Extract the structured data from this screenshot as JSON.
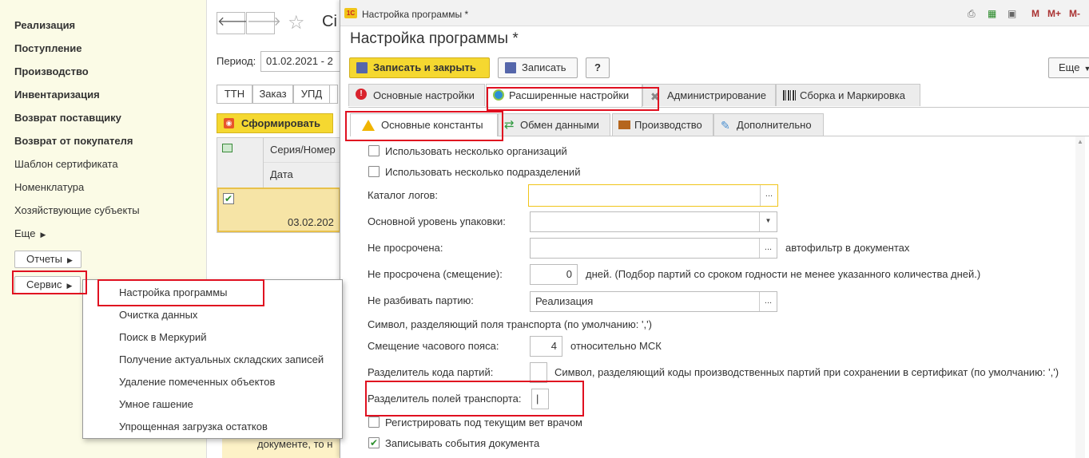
{
  "sidebar": {
    "items": [
      {
        "label": "Реализация",
        "bold": true
      },
      {
        "label": "Поступление",
        "bold": true
      },
      {
        "label": "Производство",
        "bold": true
      },
      {
        "label": "Инвентаризация",
        "bold": true
      },
      {
        "label": "Возврат поставщику",
        "bold": true
      },
      {
        "label": "Возврат от покупателя",
        "bold": true
      },
      {
        "label": "Шаблон сертификата",
        "bold": false
      },
      {
        "label": "Номенклатура",
        "bold": false
      },
      {
        "label": "Хозяйствующие субъекты",
        "bold": false
      },
      {
        "label": "Еще",
        "bold": false
      }
    ],
    "reports_label": "Отчеты",
    "service_label": "Сервис"
  },
  "menu": {
    "items": [
      "Настройка программы",
      "Очистка данных",
      "Поиск в Меркурий",
      "Получение актуальных складских записей",
      "Удаление помеченных объектов",
      "Умное гашение",
      "Упрощенная загрузка остатков"
    ]
  },
  "background": {
    "title_fragment": "Сі",
    "period_label": "Период:",
    "period_value": "01.02.2021 - 2",
    "seg_buttons": [
      "ТТН",
      "Заказ",
      "УПД"
    ],
    "generate_label": "Сформировать",
    "col_series": "Серия/Номер",
    "col_date": "Дата",
    "row_date": "03.02.202",
    "footer_text": "документе, то н"
  },
  "window": {
    "titlebar_text": "Настройка программы *",
    "titlebar_icons": [
      "М",
      "М+",
      "М-"
    ],
    "heading": "Настройка программы *",
    "save_close_label": "Записать и закрыть",
    "save_label": "Записать",
    "help_label": "?",
    "more_label": "Еще",
    "tabs": [
      "Основные настройки",
      "Расширенные настройки",
      "Администрирование",
      "Сборка и Маркировка"
    ],
    "subtabs": [
      "Основные константы",
      "Обмен данными",
      "Производство",
      "Дополнительно"
    ],
    "fields": {
      "multi_org": "Использовать несколько организаций",
      "multi_dept": "Использовать несколько подразделений",
      "log_catalog": "Каталог логов:",
      "pack_level": "Основной уровень упаковки:",
      "not_expired": "Не просрочена:",
      "not_expired_note": "автофильтр в документах",
      "not_expired_offset": "Не просрочена (смещение):",
      "offset_value": "0",
      "offset_note": "дней. (Подбор партий со сроком годности не менее указанного количества дней.)",
      "no_split": "Не разбивать партию:",
      "no_split_value": "Реализация",
      "transport_sep_note": "Символ, разделяющий поля  транспорта  (по умолчанию: ',')",
      "tz_offset": "Смещение часового пояса:",
      "tz_value": "4",
      "tz_note": "относительно МСК",
      "batch_sep": "Разделитель кода партий:",
      "batch_sep_note": "Символ, разделяющий коды производственных партий при сохранении в сертификат (по умолчанию: ',')",
      "transport_sep": "Разделитель полей транспорта:",
      "transport_sep_value": "|",
      "register_vet": "Регистрировать под текущим вет врачом",
      "log_events": "Записывать события документа"
    }
  }
}
